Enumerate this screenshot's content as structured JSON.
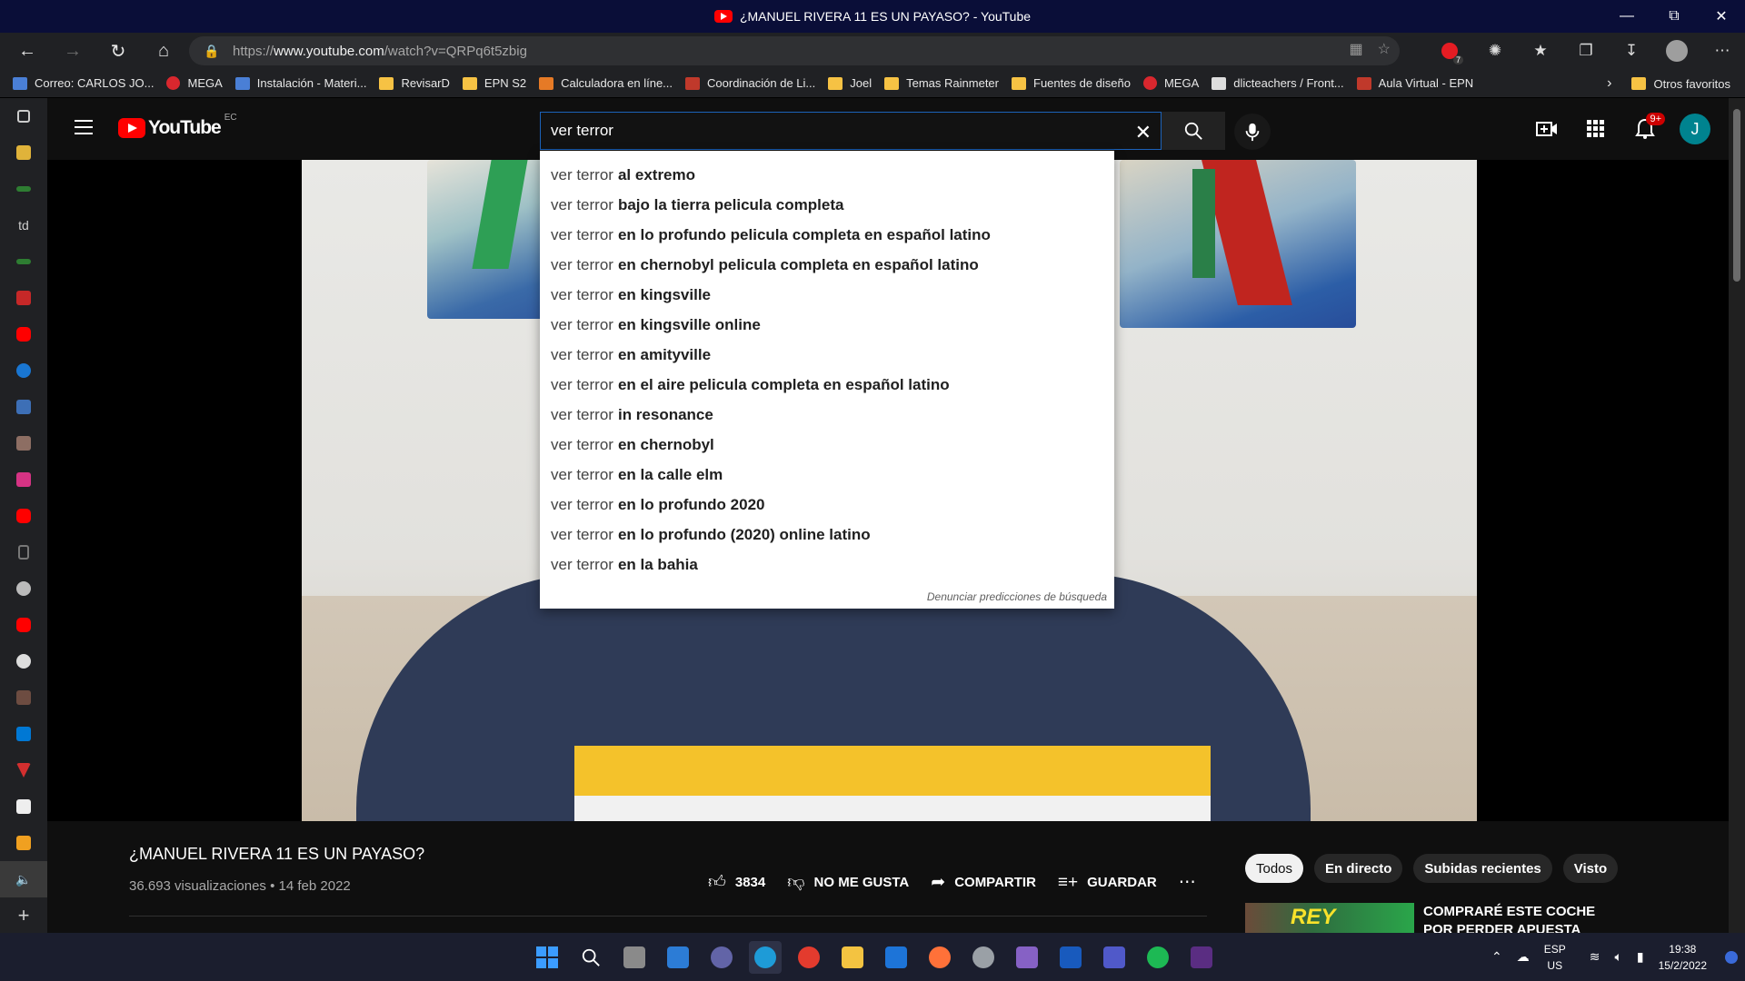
{
  "window": {
    "title": "¿MANUEL RIVERA 11 ES UN PAYASO? - YouTube"
  },
  "browser": {
    "url_prefix": "https://",
    "url_domain": "www.youtube.com",
    "url_path": "/watch?v=QRPq6t5zbig",
    "extension_badge": "7"
  },
  "bookmarks": {
    "items": [
      {
        "label": "Correo: CARLOS JO...",
        "icon": "mail-icon"
      },
      {
        "label": "MEGA",
        "icon": "mega-icon"
      },
      {
        "label": "Instalación - Materi...",
        "icon": "link-icon"
      },
      {
        "label": "RevisarD",
        "icon": "folder-icon"
      },
      {
        "label": "EPN S2",
        "icon": "folder-icon"
      },
      {
        "label": "Calculadora en líne...",
        "icon": "calculator-icon"
      },
      {
        "label": "Coordinación de Li...",
        "icon": "link-icon"
      },
      {
        "label": "Joel",
        "icon": "folder-icon"
      },
      {
        "label": "Temas Rainmeter",
        "icon": "folder-icon"
      },
      {
        "label": "Fuentes de diseño",
        "icon": "folder-icon"
      },
      {
        "label": "MEGA",
        "icon": "mega-icon"
      },
      {
        "label": "dlicteachers / Front...",
        "icon": "pb-icon"
      },
      {
        "label": "Aula Virtual - EPN",
        "icon": "link-icon"
      }
    ],
    "more": "Otros favoritos"
  },
  "youtube": {
    "logo_text": "YouTube",
    "country": "EC",
    "search_value": "ver terror",
    "notifications_badge": "9+",
    "avatar_letter": "J"
  },
  "suggestions": {
    "prefix": "ver terror",
    "items": [
      "al extremo",
      "bajo la tierra pelicula completa",
      "en lo profundo pelicula completa en español latino",
      "en chernobyl pelicula completa en español latino",
      "en kingsville",
      "en kingsville online",
      "en amityville",
      "en el aire pelicula completa en español latino",
      "in resonance",
      "en chernobyl",
      "en la calle elm",
      "en lo profundo 2020",
      "en lo profundo (2020) online latino",
      "en la bahia"
    ],
    "report": "Denunciar predicciones de búsqueda"
  },
  "video": {
    "title": "¿MANUEL RIVERA 11 ES UN PAYASO?",
    "meta": "36.693 visualizaciones • 14 feb 2022",
    "likes": "3834",
    "dislike": "NO ME GUSTA",
    "share": "COMPARTIR",
    "save": "GUARDAR"
  },
  "chips": [
    "Todos",
    "En directo",
    "Subidas recientes",
    "Visto"
  ],
  "recommendation": {
    "thumb_text": "REY BABOSO",
    "title": "COMPRARÉ ESTE COCHE POR PERDER APUESTA"
  },
  "taskbar": {
    "lang_top": "ESP",
    "lang_bottom": "US",
    "time": "19:38",
    "date": "15/2/2022"
  }
}
